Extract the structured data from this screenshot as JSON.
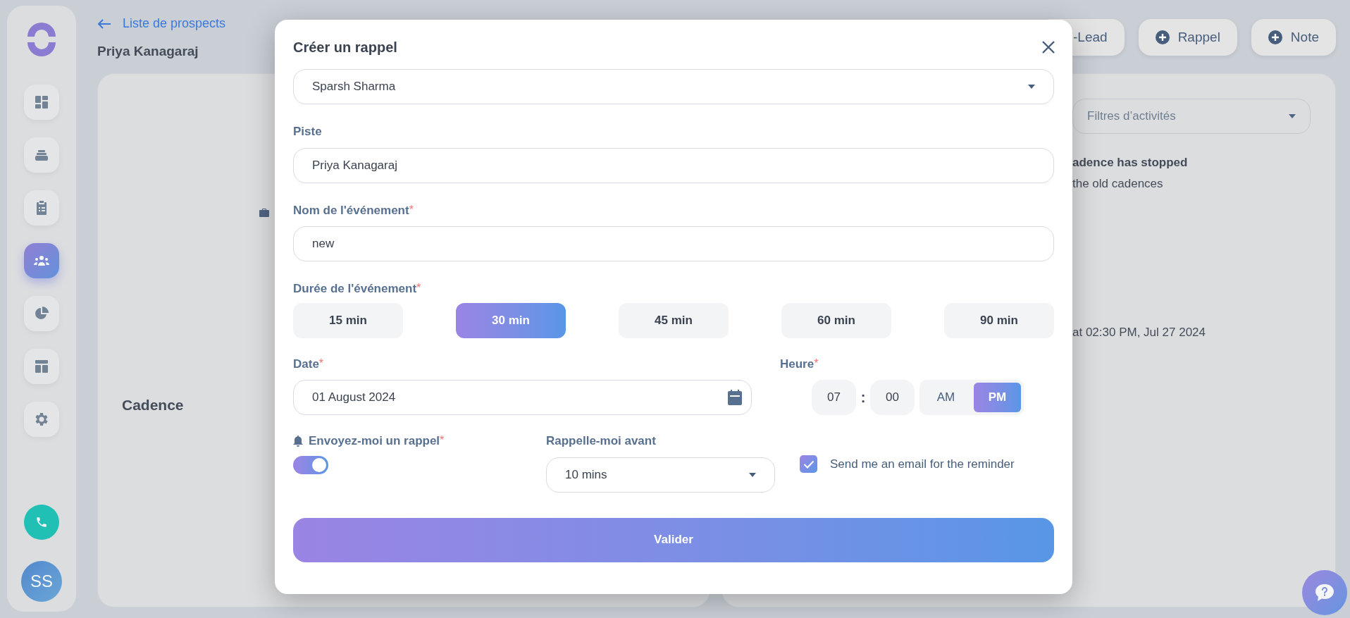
{
  "sidebar": {
    "items": [
      {
        "selected": false
      },
      {
        "selected": false
      },
      {
        "selected": false
      },
      {
        "selected": true
      },
      {
        "selected": false
      },
      {
        "selected": false
      },
      {
        "selected": false
      }
    ],
    "avatar": "SS"
  },
  "header": {
    "back_link": "Liste de prospects",
    "lead_name": "Priya Kanagaraj",
    "buttons": [
      {
        "label": "-Lead",
        "kind": "plain"
      },
      {
        "label": "Rappel",
        "kind": "plus"
      },
      {
        "label": "Note",
        "kind": "plus"
      }
    ]
  },
  "left_card": {
    "section": "Cadence"
  },
  "right_card": {
    "filter": {
      "placeholder": "Filtres d’activités"
    },
    "lines": [
      {
        "text": "adence has stopped",
        "bold": true
      },
      {
        "text": "the old cadences",
        "bold": false
      },
      {
        "text": "at 02:30 PM, Jul 27 2024",
        "bold": false
      }
    ]
  },
  "modal": {
    "title": "Créer un rappel",
    "user_select": "Sparsh Sharma",
    "fields": [
      {
        "label": "Piste",
        "value": "Priya Kanagaraj"
      },
      {
        "label": "Nom de l'événement",
        "required_mark": "*",
        "value": "new"
      }
    ],
    "duration": {
      "label": "Durée de l'événement",
      "required_mark": "*",
      "options": [
        {
          "label": "15 min",
          "selected": false
        },
        {
          "label": "30 min",
          "selected": true
        },
        {
          "label": "45 min",
          "selected": false
        },
        {
          "label": "60 min",
          "selected": false
        },
        {
          "label": "90 min",
          "selected": false
        }
      ]
    },
    "date": {
      "label": "Date",
      "required_mark": "*",
      "value": "01 August 2024"
    },
    "time": {
      "label": "Heure",
      "required_mark": "*",
      "hour": "07",
      "separator": ":",
      "minute": "00",
      "periods": [
        {
          "label": "AM",
          "selected": false
        },
        {
          "label": "PM",
          "selected": true
        }
      ]
    },
    "reminder": {
      "label": "Envoyez-moi un rappel",
      "required_mark": "*",
      "on": true
    },
    "remind_before": {
      "label": "Rappelle-moi avant",
      "value": "10 mins"
    },
    "email": {
      "label": "Send me an email for the reminder",
      "checked": true
    },
    "submit": "Valider"
  }
}
